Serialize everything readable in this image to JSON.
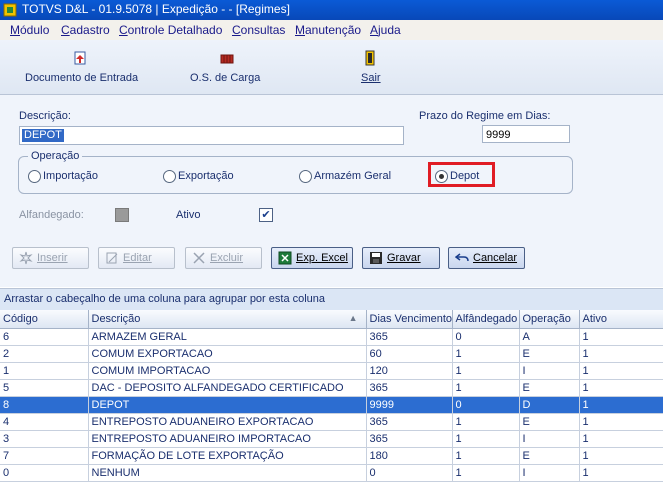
{
  "window": {
    "title": "TOTVS D&L - 01.9.5078 | Expedição - - [Regimes]"
  },
  "menu": [
    "Módulo",
    "Cadastro",
    "Controle Detalhado",
    "Consultas",
    "Manutenção",
    "Ajuda"
  ],
  "toolbar": {
    "documento_label": "Documento de Entrada",
    "os_label": "O.S. de Carga",
    "sair_label": "Sair"
  },
  "form": {
    "descricao_label": "Descrição:",
    "descricao_value": "DEPOT",
    "prazo_label": "Prazo do Regime em Dias:",
    "prazo_value": "9999",
    "operacao_label": "Operação",
    "operacao_options": [
      "Importação",
      "Exportação",
      "Armazém Geral",
      "Depot"
    ],
    "operacao_selected": "Depot",
    "alfandegado_label": "Alfandegado:",
    "alfandegado_checked": false,
    "ativo_label": "Ativo",
    "ativo_checked": true
  },
  "buttons": {
    "inserir": "Inserir",
    "editar": "Editar",
    "excluir": "Excluir",
    "exp_excel": "Exp. Excel",
    "gravar": "Gravar",
    "cancelar": "Cancelar"
  },
  "grid": {
    "group_hint": "Arrastar o cabeçalho de uma coluna para agrupar por esta coluna",
    "columns": [
      "Código",
      "Descrição",
      "Dias Vencimento",
      "Alfândegado",
      "Operação",
      "Ativo"
    ],
    "sorted_column": "Descrição",
    "rows": [
      [
        "6",
        "ARMAZEM GERAL",
        "365",
        "0",
        "A",
        "1"
      ],
      [
        "2",
        "COMUM EXPORTACAO",
        "60",
        "1",
        "E",
        "1"
      ],
      [
        "1",
        "COMUM IMPORTACAO",
        "120",
        "1",
        "I",
        "1"
      ],
      [
        "5",
        "DAC - DEPOSITO ALFANDEGADO CERTIFICADO",
        "365",
        "1",
        "E",
        "1"
      ],
      [
        "8",
        "DEPOT",
        "9999",
        "0",
        "D",
        "1"
      ],
      [
        "4",
        "ENTREPOSTO ADUANEIRO EXPORTACAO",
        "365",
        "1",
        "E",
        "1"
      ],
      [
        "3",
        "ENTREPOSTO ADUANEIRO IMPORTACAO",
        "365",
        "1",
        "I",
        "1"
      ],
      [
        "7",
        "FORMAÇÃO DE LOTE EXPORTAÇÃO",
        "180",
        "1",
        "E",
        "1"
      ],
      [
        "0",
        "NENHUM",
        "0",
        "1",
        "I",
        "1"
      ]
    ],
    "selected_row": 4
  },
  "colors": {
    "title_bar": "#0848b8",
    "selection": "#2c6dd1",
    "highlight_box": "#e01c24"
  }
}
